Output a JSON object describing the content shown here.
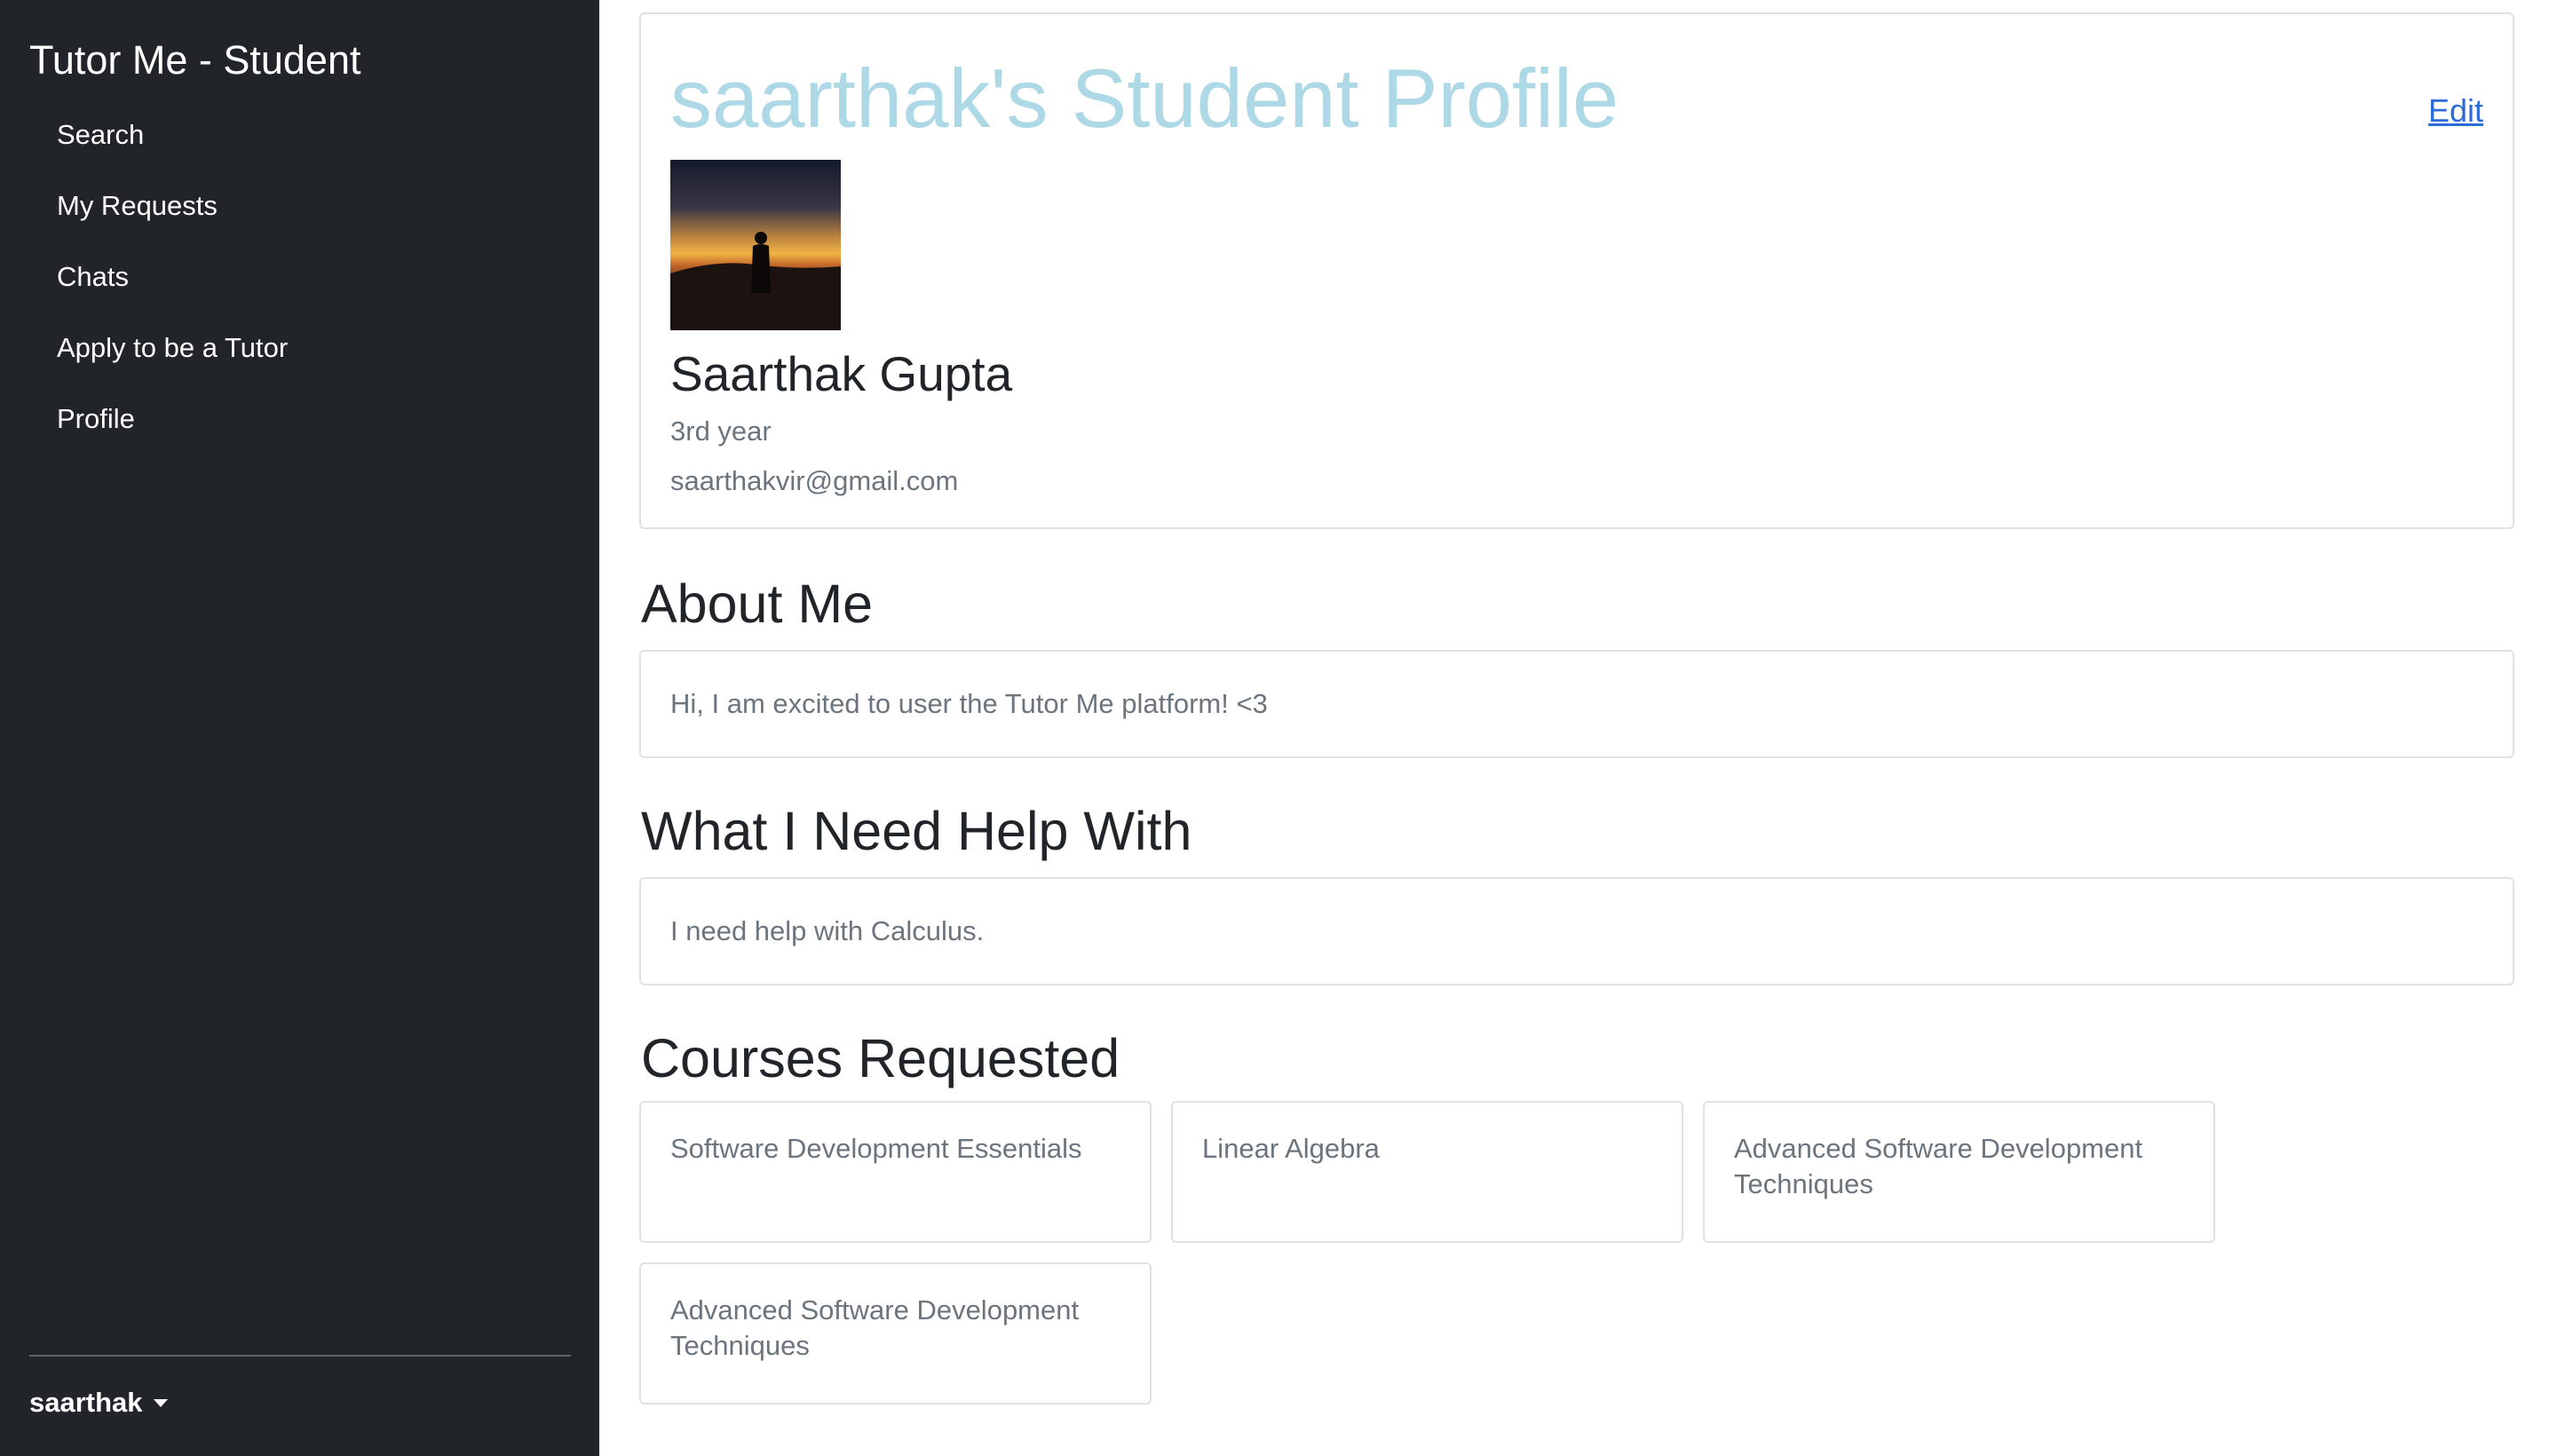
{
  "sidebar": {
    "brand": "Tutor Me - Student",
    "items": [
      {
        "label": "Search"
      },
      {
        "label": "My Requests"
      },
      {
        "label": "Chats"
      },
      {
        "label": "Apply to be a Tutor"
      },
      {
        "label": "Profile"
      }
    ],
    "user": "saarthak"
  },
  "profile": {
    "title": "saarthak's Student Profile",
    "edit_label": "Edit",
    "name": "Saarthak Gupta",
    "year": "3rd year",
    "email": "saarthakvir@gmail.com"
  },
  "about": {
    "heading": "About Me",
    "text": "Hi, I am excited to user the Tutor Me platform! <3"
  },
  "help": {
    "heading": "What I Need Help With",
    "text": "I need help with Calculus."
  },
  "courses": {
    "heading": "Courses Requested",
    "items": [
      {
        "name": "Software Development Essentials"
      },
      {
        "name": "Linear Algebra"
      },
      {
        "name": "Advanced Software Development Techniques"
      },
      {
        "name": "Advanced Software Development Techniques"
      }
    ]
  },
  "colors": {
    "sidebar_bg": "#212529",
    "title_color": "#add8e6",
    "link_color": "#2b6cd8",
    "muted_text": "#6c757d"
  }
}
